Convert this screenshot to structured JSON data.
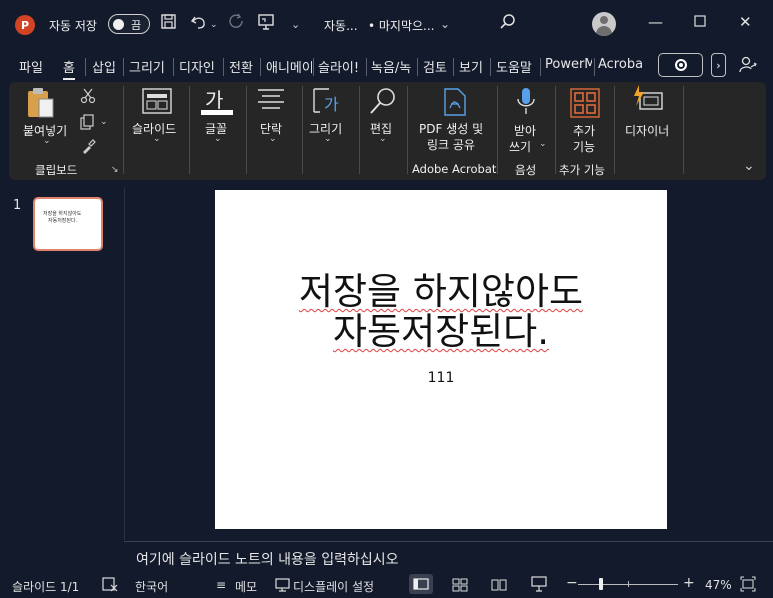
{
  "titlebar": {
    "app_logo": "P",
    "autosave_label": "자동 저장",
    "autosave_state": "끔",
    "file_name": "자동...",
    "status": "• 마지막으...",
    "icons": [
      "save-icon",
      "undo-icon",
      "redo-icon",
      "present-icon",
      "customize-icon",
      "search-icon",
      "avatar-icon",
      "minimize-icon",
      "maximize-icon",
      "close-icon"
    ]
  },
  "tabs": [
    "파일",
    "홈",
    "삽입",
    "그리기",
    "디자인",
    "전환",
    "애니메이",
    "슬라이!",
    "녹음/녹",
    "검토",
    "보기",
    "도움말",
    "PowerM",
    "Acroba"
  ],
  "ribbon": {
    "clipboard": {
      "paste": "붙여넣기",
      "group": "클립보드"
    },
    "slides": "슬라이드",
    "font": "글꼴",
    "paragraph": "단락",
    "drawing": "그리기",
    "editing": "편집",
    "acrobat": {
      "line1": "PDF 생성 및",
      "line2": "링크 공유",
      "group": "Adobe Acrobat"
    },
    "voice": {
      "line1": "받아",
      "line2": "쓰기",
      "group": "음성"
    },
    "addins": {
      "line1": "추가",
      "line2": "기능",
      "group": "추가 기능"
    },
    "designer": "디자이너",
    "font_icon_glyph": "가",
    "drawing_icon_glyph": "가"
  },
  "slides": [
    {
      "number": "1",
      "thumb_line1": "저장을 하지않아도",
      "thumb_line2": "자동저장된다."
    }
  ],
  "slide": {
    "title_line1": "저장을 하지않아도",
    "title_line2": "자동저장된다.",
    "subtitle": "111"
  },
  "notes": {
    "placeholder": "여기에 슬라이드 노트의 내용을 입력하십시오"
  },
  "status": {
    "slide_counter": "슬라이드 1/1",
    "language": "한국어",
    "notes": "메모",
    "display": "디스플레이 설정",
    "zoom": "47%"
  },
  "colors": {
    "accent_ppt": "#d04423",
    "thumb_border": "#e0826c",
    "spell_underline": "#e04040"
  }
}
